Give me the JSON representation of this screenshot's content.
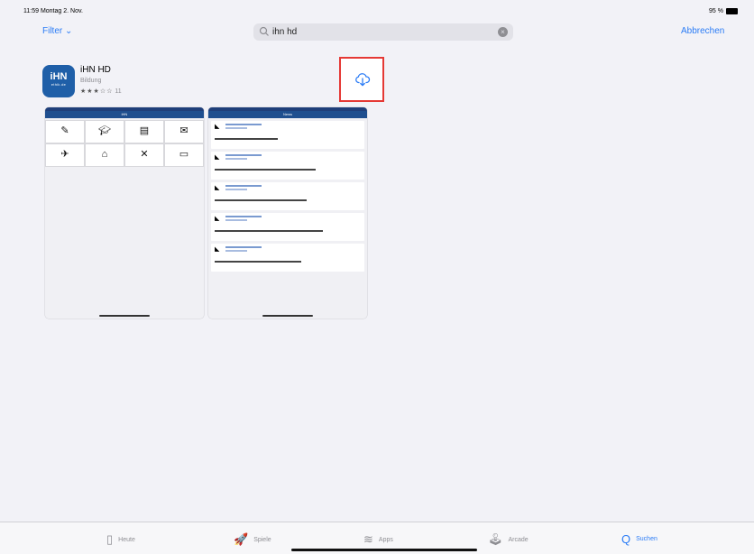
{
  "status": {
    "time_date": "11:59  Montag 2. Nov.",
    "battery": "95 %"
  },
  "topbar": {
    "filter_label": "Filter",
    "search_value": "ihn hd",
    "cancel_label": "Abbrechen"
  },
  "app": {
    "icon_text": "iHN",
    "icon_subtext": "ethik.de",
    "name": "iHN HD",
    "category": "Bildung",
    "stars": "★★★☆☆",
    "rating_count": "11"
  },
  "screenshot1": {
    "title": "iHN"
  },
  "screenshot2": {
    "title": "News"
  },
  "tabs": [
    {
      "label": "Heute",
      "icon": "today-icon",
      "glyph": "▯"
    },
    {
      "label": "Spiele",
      "icon": "games-rocket-icon",
      "glyph": "🚀"
    },
    {
      "label": "Apps",
      "icon": "apps-stack-icon",
      "glyph": "≋"
    },
    {
      "label": "Arcade",
      "icon": "arcade-joystick-icon",
      "glyph": "🕹"
    },
    {
      "label": "Suchen",
      "icon": "search-icon",
      "glyph": "Q"
    }
  ],
  "colors": {
    "accent": "#2b7cf6",
    "app_icon": "#1f5fa8",
    "highlight": "#e53935"
  }
}
